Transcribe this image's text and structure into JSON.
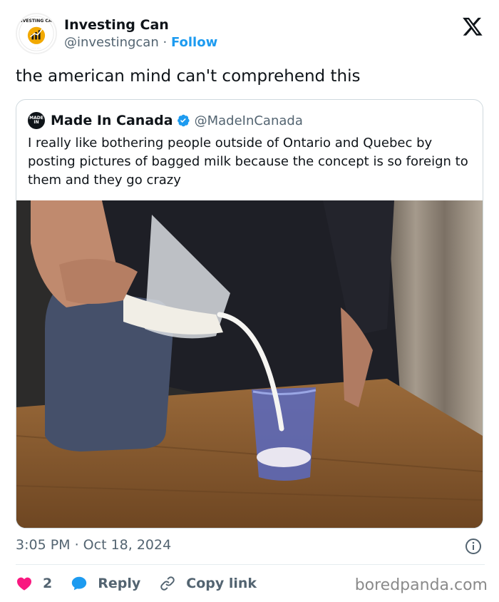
{
  "author": {
    "name": "Investing Can",
    "handle": "@investingcan",
    "separator": "·",
    "follow_label": "Follow",
    "avatar_text": "INVESTING CAN"
  },
  "tweet": {
    "text": "the american mind can't comprehend this"
  },
  "quoted": {
    "avatar_text": "MADE IN",
    "name": "Made In Canada",
    "handle": "@MadeInCanada",
    "text": "I really like bothering people outside of Ontario and Quebec by posting pictures of bagged milk because the concept is so foreign to them and they go crazy",
    "image_icon": "milk-pouring-photo"
  },
  "meta": {
    "timestamp": "3:05 PM · Oct 18, 2024"
  },
  "actions": {
    "likes_count": "2",
    "reply_label": "Reply",
    "copy_label": "Copy link"
  },
  "watermark": "boredpanda.com",
  "colors": {
    "accent": "#1d9bf0",
    "like": "#f91880",
    "text": "#0f1419",
    "muted": "#536471"
  }
}
